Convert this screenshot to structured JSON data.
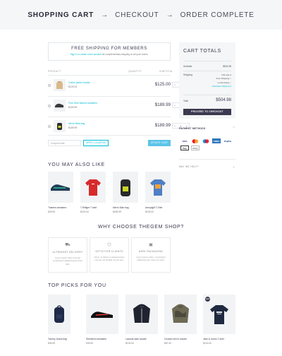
{
  "steps": [
    {
      "label": "SHOPPING CART"
    },
    {
      "label": "CHECKOUT"
    },
    {
      "label": "ORDER COMPLETE"
    }
  ],
  "shipping_notice": {
    "title": "FREE SHIPPING FOR MEMBERS",
    "link": "Sign in or create a free account",
    "text": "for complementary shipping on all your orders."
  },
  "cart": {
    "headers": {
      "product": "PRODUCT",
      "quantity": "QUANTITY",
      "subtotal": "SUBTOTAL"
    },
    "items": [
      {
        "name": "Cotton jacket hoodie",
        "price": "$125.00",
        "qty": "1",
        "subtotal": "$125.00"
      },
      {
        "name": "Polo Shirt fashion sweaters",
        "price": "$189.99",
        "qty": "1",
        "subtotal": "$189.99"
      },
      {
        "name": "Men's Nike bag",
        "price": "$189.99",
        "qty": "1",
        "subtotal": "$189.99"
      }
    ],
    "coupon_placeholder": "Coupon code",
    "apply_label": "APPLY COUPON",
    "update_label": "UPDATE CART"
  },
  "totals": {
    "title": "CART TOTALS",
    "subtotal_label": "Subtotal",
    "subtotal_value": "$504.98",
    "shipping_label": "Shipping",
    "shipping_options": [
      "Flat rate",
      "Free Shipping",
      "Local pickup",
      "Calculate Shipping"
    ],
    "total_label": "Total",
    "total_value": "$504.98",
    "checkout_label": "PROCEED TO CHECKOUT",
    "payment_methods_label": "PAYMENT METHODS",
    "payment_brands": [
      "VISA",
      "MC",
      "MC",
      "AMEX",
      "PayPal",
      "Pay",
      "GPay"
    ],
    "help_label": "MAY WE HELP?"
  },
  "also_like": {
    "title": "YOU MAY ALSO LIKE",
    "products": [
      {
        "name": "Trainers sneakers",
        "price": "$39.99"
      },
      {
        "name": "T-Hilfiger T-shirt",
        "price": "$100.00"
      },
      {
        "name": "Men's Nike bag",
        "price": "$185.99"
      },
      {
        "name": "Aeropiglit T-Shirt",
        "price": "$135.00"
      }
    ]
  },
  "why": {
    "title": "WHY CHOOSE THEGEM SHOP?",
    "features": [
      {
        "name": "ULTRAFAST DELIVERY",
        "desc": "Lorem ipsum dolor sit amet consectetur adipiscing elit tortor nibh."
      },
      {
        "name": "GIFTS FOR CLIENTS",
        "desc": "Tortor mi dictum ut aliquet luctus viverra, vel fringilla cursus sed."
      },
      {
        "name": "SAFE PACKAGING",
        "desc": "Lorem ipsum dolor, consectetur adipiscing elit, quis orci amet."
      }
    ]
  },
  "top_picks": {
    "title": "TOP PICKS FOR YOU",
    "badge": "NEW",
    "products": [
      {
        "name": "Tommy Jeans bag",
        "price": "$35.99"
      },
      {
        "name": "Sheinmint sneakers",
        "price": "$39.99"
      },
      {
        "name": "Lacoste dark hoodie",
        "price": "$125.00"
      },
      {
        "name": "Custom men's hoodie",
        "price": "$87.00"
      },
      {
        "name": "Jack & Jones T-shirt",
        "price": "$149.00"
      }
    ]
  },
  "colors": {
    "accent": "#00bcd4",
    "button_dark": "#3c3950",
    "panel_bg": "#f4f6f7"
  }
}
